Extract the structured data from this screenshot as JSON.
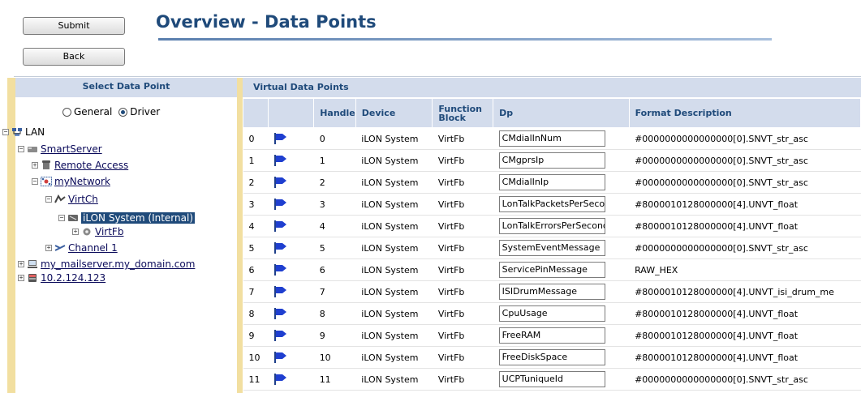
{
  "buttons": {
    "submit": "Submit",
    "back": "Back"
  },
  "page_title": "Overview - Data Points",
  "left_panel": {
    "heading": "Select Data Point",
    "radio_general": "General",
    "radio_driver": "Driver",
    "selected_radio": "Driver"
  },
  "tree": {
    "lan": "LAN",
    "smartserver": "SmartServer",
    "remote_access": "Remote Access",
    "mynetwork": "myNetwork",
    "virtch": "VirtCh",
    "ilon_system": "iLON System (Internal)",
    "virtfb": "VirtFb",
    "channel1": "Channel 1",
    "mailserver": "my_mailserver.my_domain.com",
    "ip": "10.2.124.123"
  },
  "table": {
    "title": "Virtual Data Points",
    "headers": {
      "handle": "Handle",
      "device": "Device",
      "function_block": "Function Block",
      "dp": "Dp",
      "format": "Format Description"
    },
    "rows": [
      {
        "idx": "0",
        "handle": "0",
        "device": "iLON System",
        "fb": "VirtFb",
        "dp": "CMdialInNum",
        "format": "#0000000000000000[0].SNVT_str_asc"
      },
      {
        "idx": "1",
        "handle": "1",
        "device": "iLON System",
        "fb": "VirtFb",
        "dp": "CMgprsIp",
        "format": "#0000000000000000[0].SNVT_str_asc"
      },
      {
        "idx": "2",
        "handle": "2",
        "device": "iLON System",
        "fb": "VirtFb",
        "dp": "CMdialInIp",
        "format": "#0000000000000000[0].SNVT_str_asc"
      },
      {
        "idx": "3",
        "handle": "3",
        "device": "iLON System",
        "fb": "VirtFb",
        "dp": "LonTalkPacketsPerSecond",
        "format": "#8000010128000000[4].UNVT_float"
      },
      {
        "idx": "4",
        "handle": "4",
        "device": "iLON System",
        "fb": "VirtFb",
        "dp": "LonTalkErrorsPerSecond",
        "format": "#8000010128000000[4].UNVT_float"
      },
      {
        "idx": "5",
        "handle": "5",
        "device": "iLON System",
        "fb": "VirtFb",
        "dp": "SystemEventMessage",
        "format": "#0000000000000000[0].SNVT_str_asc"
      },
      {
        "idx": "6",
        "handle": "6",
        "device": "iLON System",
        "fb": "VirtFb",
        "dp": "ServicePinMessage",
        "format": "RAW_HEX"
      },
      {
        "idx": "7",
        "handle": "7",
        "device": "iLON System",
        "fb": "VirtFb",
        "dp": "ISIDrumMessage",
        "format": "#8000010128000000[4].UNVT_isi_drum_me"
      },
      {
        "idx": "8",
        "handle": "8",
        "device": "iLON System",
        "fb": "VirtFb",
        "dp": "CpuUsage",
        "format": "#8000010128000000[4].UNVT_float"
      },
      {
        "idx": "9",
        "handle": "9",
        "device": "iLON System",
        "fb": "VirtFb",
        "dp": "FreeRAM",
        "format": "#8000010128000000[4].UNVT_float"
      },
      {
        "idx": "10",
        "handle": "10",
        "device": "iLON System",
        "fb": "VirtFb",
        "dp": "FreeDiskSpace",
        "format": "#8000010128000000[4].UNVT_float"
      },
      {
        "idx": "11",
        "handle": "11",
        "device": "iLON System",
        "fb": "VirtFb",
        "dp": "UCPTuniqueId",
        "format": "#0000000000000000[0].SNVT_str_asc"
      }
    ]
  },
  "colors": {
    "accent": "#1f4a7a",
    "header_bg": "#d3dcec",
    "strip": "#f2dfa0"
  }
}
